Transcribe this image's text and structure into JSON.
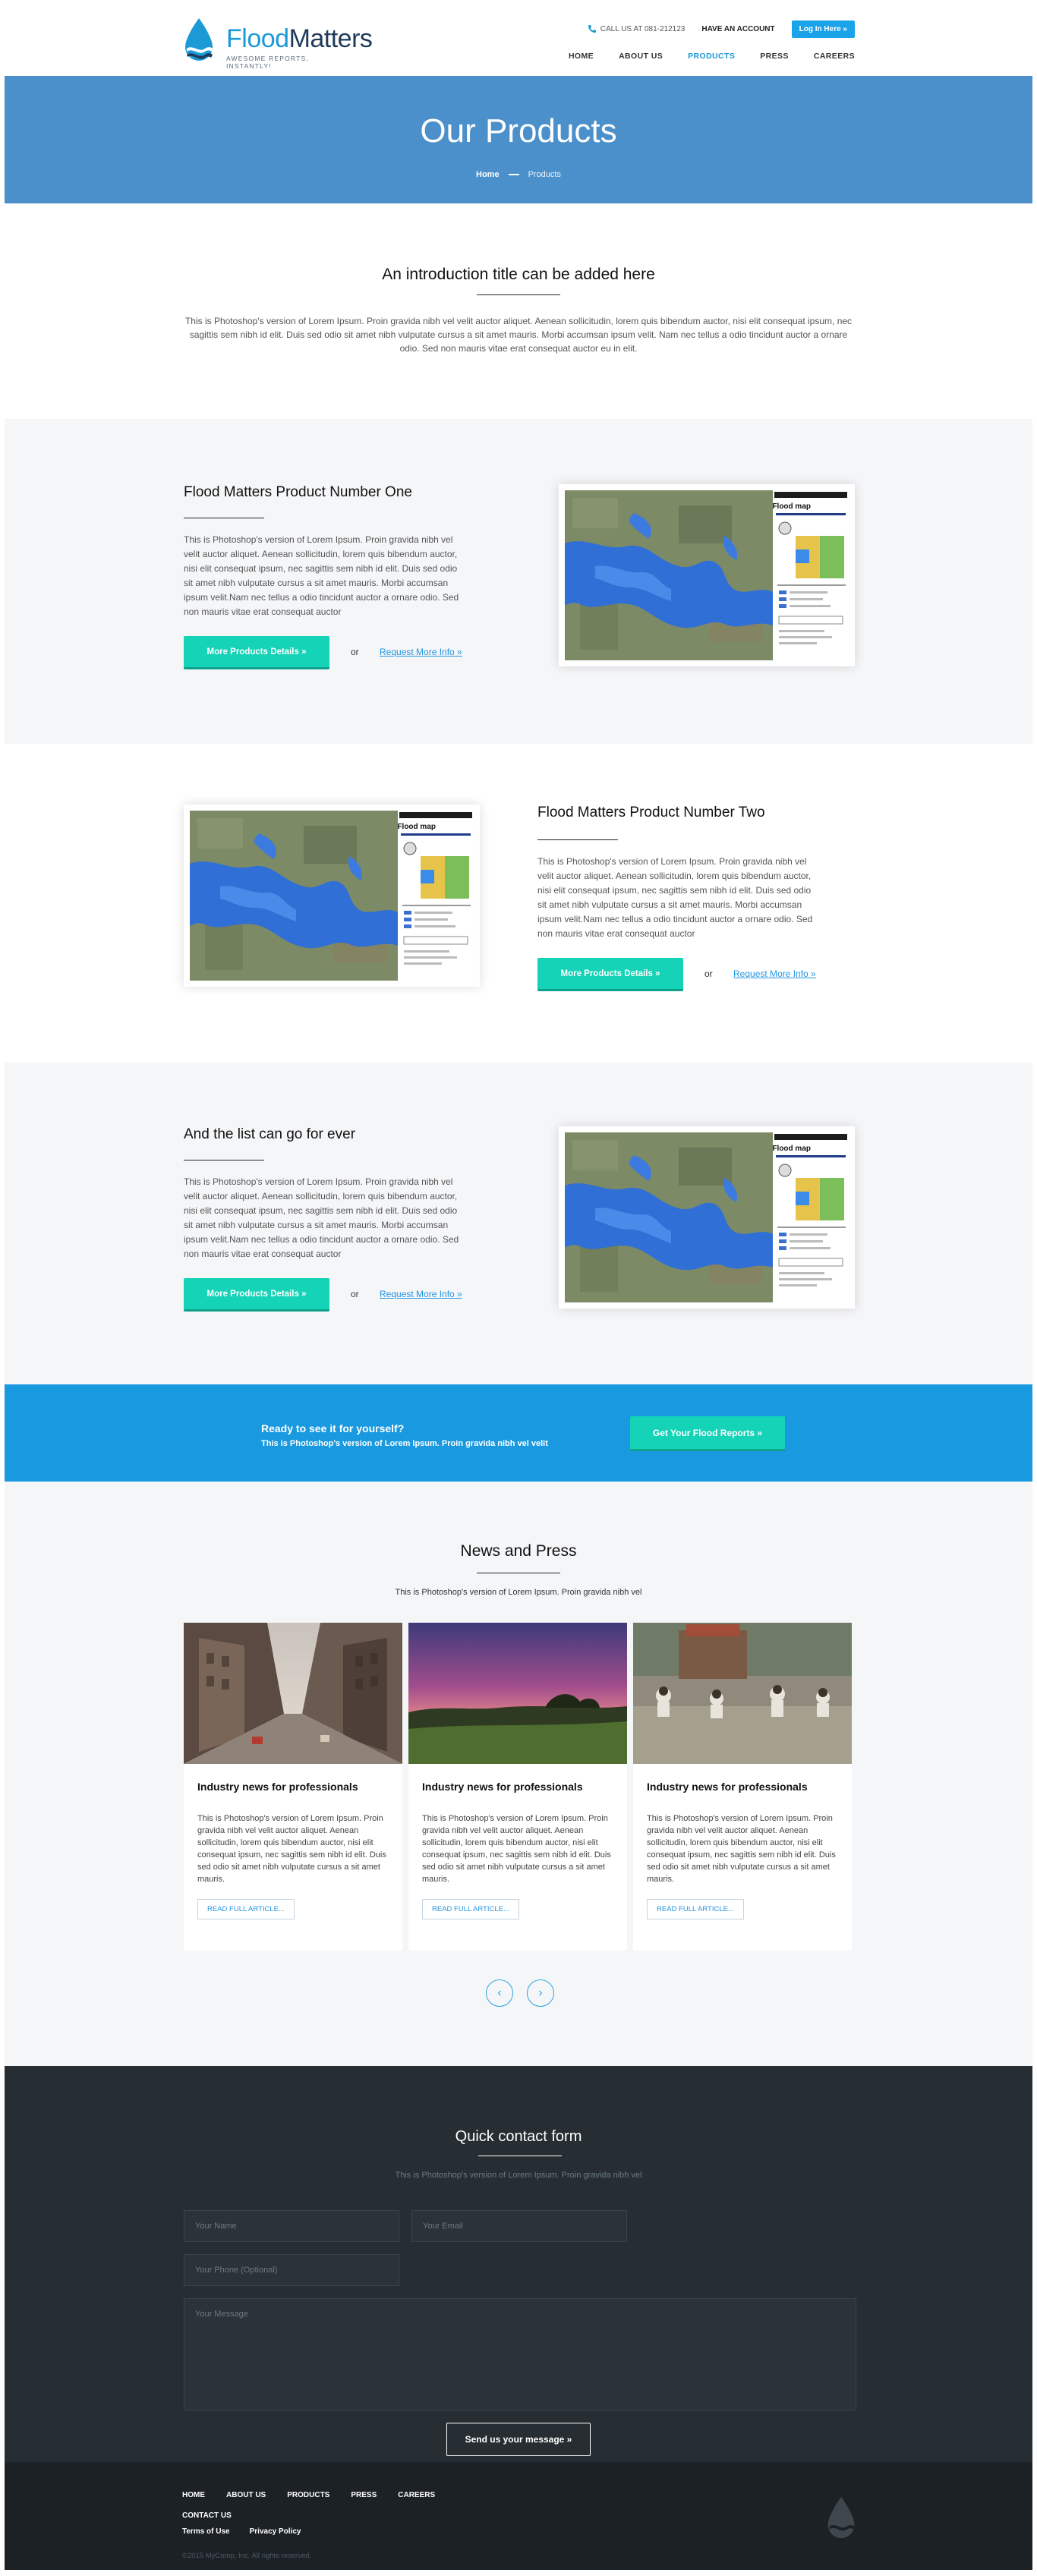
{
  "header": {
    "brand_part1": "Flood",
    "brand_part2": "Matters",
    "tagline": "AWESOME REPORTS, INSTANTLY!",
    "call": "CALL US AT 081-212123",
    "have_account": "HAVE AN ACCOUNT",
    "login": "Log In Here »",
    "nav": [
      "HOME",
      "ABOUT US",
      "PRODUCTS",
      "PRESS",
      "CAREERS"
    ],
    "active_nav": "PRODUCTS"
  },
  "hero": {
    "title": "Our Products",
    "breadcrumb_home": "Home",
    "breadcrumb_current": "Products"
  },
  "intro": {
    "title": "An introduction title can be added here",
    "text": "This is Photoshop's version of Lorem Ipsum. Proin gravida nibh vel velit auctor aliquet. Aenean sollicitudin, lorem quis bibendum auctor, nisi elit consequat ipsum, nec sagittis sem nibh id elit. Duis sed odio sit amet nibh vulputate cursus a sit amet mauris. Morbi accumsan ipsum velit. Nam nec tellus a odio tincidunt auctor a ornare odio. Sed non mauris vitae erat consequat auctor eu in elit."
  },
  "products": [
    {
      "title": "Flood Matters Product Number One",
      "text": "This is Photoshop's version of Lorem Ipsum. Proin gravida nibh vel velit auctor aliquet. Aenean sollicitudin, lorem quis bibendum auctor, nisi elit consequat ipsum, nec sagittis sem nibh id elit. Duis sed odio sit amet nibh vulputate cursus a sit amet mauris. Morbi accumsan ipsum velit.Nam nec tellus a odio tincidunt auctor a ornare odio. Sed non mauris vitae erat consequat auctor",
      "button": "More Products Details »",
      "or": "or",
      "request": "Request More Info »"
    },
    {
      "title": "Flood Matters Product Number Two",
      "text": "This is Photoshop's version of Lorem Ipsum. Proin gravida nibh vel velit auctor aliquet. Aenean sollicitudin, lorem quis bibendum auctor, nisi elit consequat ipsum, nec sagittis sem nibh id elit. Duis sed odio sit amet nibh vulputate cursus a sit amet mauris. Morbi accumsan ipsum velit.Nam nec tellus a odio tincidunt auctor a ornare odio. Sed non mauris vitae erat consequat auctor",
      "button": "More Products Details »",
      "or": "or",
      "request": "Request More Info »"
    },
    {
      "title": "And the list can go for ever",
      "text": "This is Photoshop's version of Lorem Ipsum. Proin gravida nibh vel velit auctor aliquet. Aenean sollicitudin, lorem quis bibendum auctor, nisi elit consequat ipsum, nec sagittis sem nibh id elit. Duis sed odio sit amet nibh vulputate cursus a sit amet mauris. Morbi accumsan ipsum velit.Nam nec tellus a odio tincidunt auctor a ornare odio. Sed non mauris vitae erat consequat auctor",
      "button": "More Products Details »",
      "or": "or",
      "request": "Request More Info »"
    }
  ],
  "map": {
    "panel_title": "Flood map"
  },
  "cta": {
    "title": "Ready to see it for yourself?",
    "text": "This is Photoshop's version of Lorem Ipsum. Proin gravida nibh vel velit",
    "button": "Get Your Flood Reports »"
  },
  "news": {
    "title": "News and Press",
    "subtitle": "This is Photoshop's version of Lorem Ipsum. Proin gravida nibh vel",
    "cards": [
      {
        "title": "Industry news for professionals",
        "text": "This is Photoshop's version of Lorem Ipsum. Proin gravida nibh vel velit auctor aliquet. Aenean sollicitudin, lorem quis bibendum auctor, nisi elit consequat ipsum, nec sagittis sem nibh id elit. Duis sed odio sit amet nibh vulputate cursus a sit amet mauris.",
        "read": "READ FULL ARTICLE..."
      },
      {
        "title": "Industry news for professionals",
        "text": "This is Photoshop's version of Lorem Ipsum. Proin gravida nibh vel velit auctor aliquet. Aenean sollicitudin, lorem quis bibendum auctor, nisi elit consequat ipsum, nec sagittis sem nibh id elit. Duis sed odio sit amet nibh vulputate cursus a sit amet mauris.",
        "read": "READ FULL ARTICLE..."
      },
      {
        "title": "Industry news for professionals",
        "text": "This is Photoshop's version of Lorem Ipsum. Proin gravida nibh vel velit auctor aliquet. Aenean sollicitudin, lorem quis bibendum auctor, nisi elit consequat ipsum, nec sagittis sem nibh id elit. Duis sed odio sit amet nibh vulputate cursus a sit amet mauris.",
        "read": "READ FULL ARTICLE..."
      }
    ],
    "prev": "‹",
    "next": "›"
  },
  "contact": {
    "title": "Quick contact form",
    "subtitle": "This is Photoshop's version of Lorem Ipsum. Proin gravida nibh vel",
    "name_placeholder": "Your Name",
    "email_placeholder": "Your Email",
    "phone_placeholder": "Your Phone (Optional)",
    "message_placeholder": "Your Message",
    "send": "Send us your message »"
  },
  "footer": {
    "nav": [
      "HOME",
      "ABOUT US",
      "PRODUCTS",
      "PRESS",
      "CAREERS"
    ],
    "contact": "CONTACT US",
    "terms": "Terms of Use",
    "privacy": "Privacy Policy",
    "copyright": "©2015 MyComp, Inc. All rights reserved."
  },
  "colors": {
    "brand_blue": "#1b9ad6",
    "hero_blue": "#4b90ca",
    "cta_blue": "#1899e0",
    "teal_button": "#14d3b6",
    "dark_section": "#272e33",
    "footer": "#1c2126"
  }
}
